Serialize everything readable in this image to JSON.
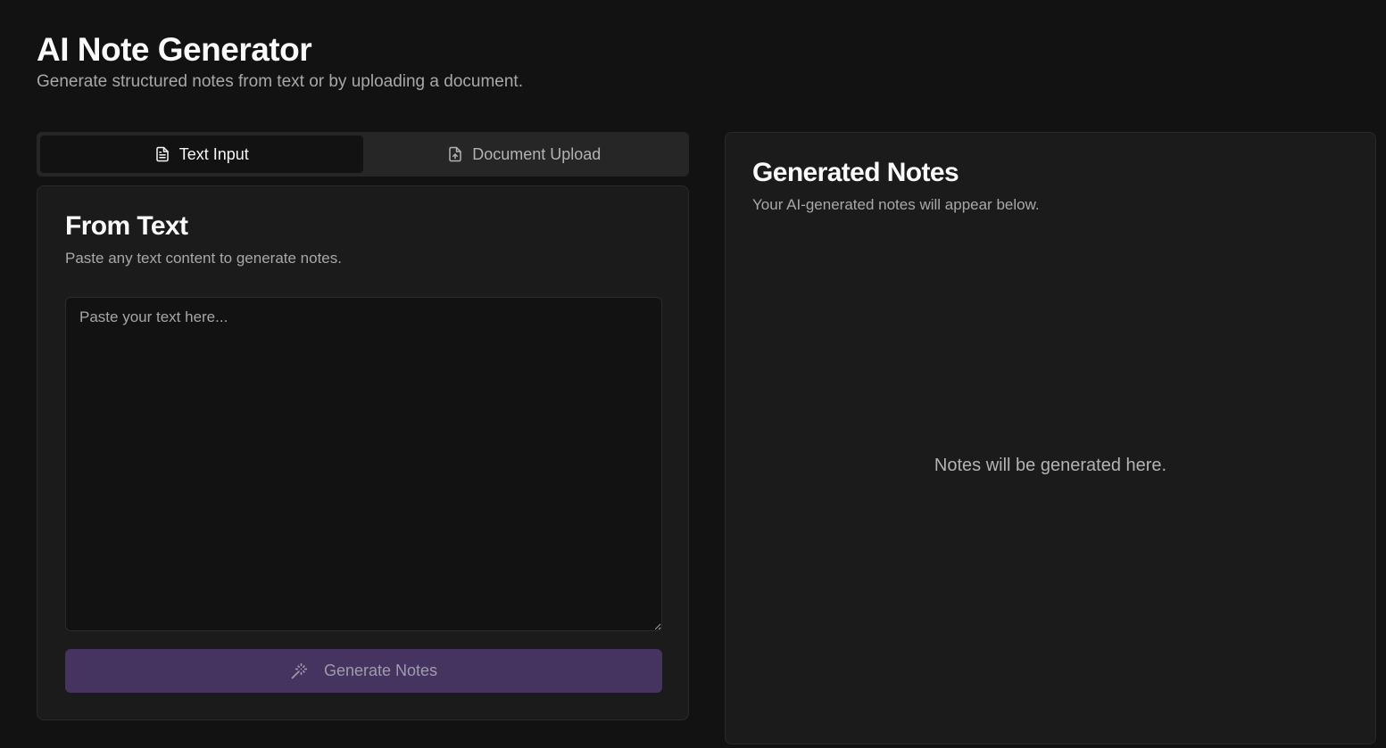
{
  "header": {
    "title": "AI Note Generator",
    "subtitle": "Generate structured notes from text or by uploading a document."
  },
  "tabs": [
    {
      "label": "Text Input",
      "icon": "file-text-icon",
      "active": true
    },
    {
      "label": "Document Upload",
      "icon": "file-upload-icon",
      "active": false
    }
  ],
  "input_card": {
    "title": "From Text",
    "description": "Paste any text content to generate notes.",
    "textarea": {
      "placeholder": "Paste your text here...",
      "value": ""
    },
    "generate_button": {
      "label": "Generate Notes",
      "icon": "magic-wand-icon",
      "disabled": true
    }
  },
  "output_card": {
    "title": "Generated Notes",
    "description": "Your AI-generated notes will appear below.",
    "empty_message": "Notes will be generated here."
  },
  "colors": {
    "background": "#121212",
    "card": "#1b1b1b",
    "button_accent": "#44345f"
  }
}
